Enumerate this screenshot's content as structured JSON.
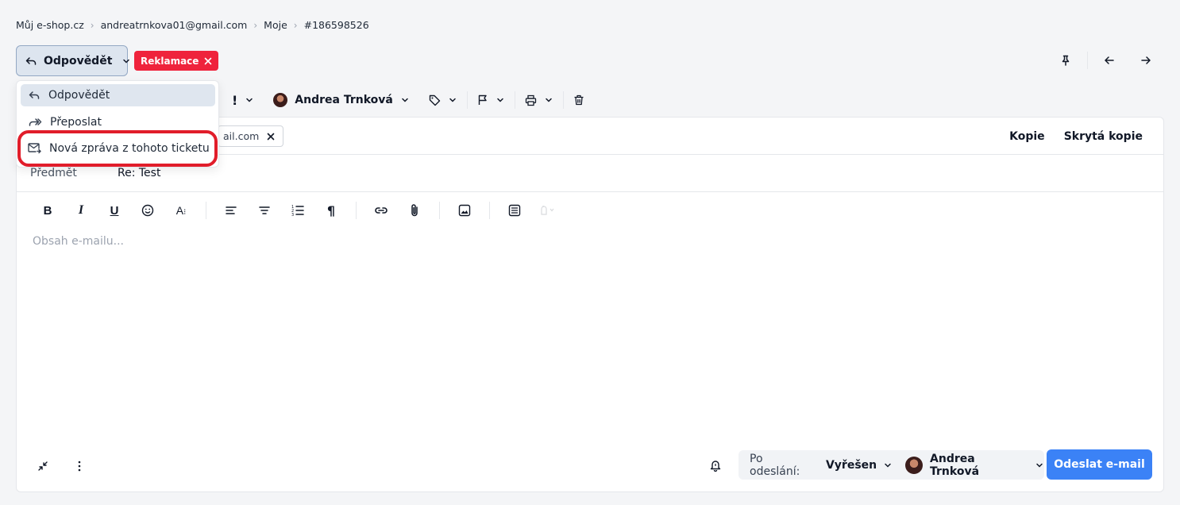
{
  "breadcrumb": [
    "Můj e-shop.cz",
    "andreatrnkova01@gmail.com",
    "Moje",
    "#186598526"
  ],
  "reply_button": {
    "label": "Odpovědět"
  },
  "tag": {
    "label": "Reklamace",
    "color": "#ef233c"
  },
  "dropdown": {
    "items": [
      {
        "label": "Odpovědět",
        "icon": "reply-icon",
        "active": true
      },
      {
        "label": "Přeposlat",
        "icon": "forward-icon"
      },
      {
        "label": "Nová zpráva z tohoto ticketu",
        "icon": "new-mail-icon",
        "highlighted": true
      }
    ]
  },
  "toolbar": {
    "priority": "!",
    "assignee": "Andrea Trnková"
  },
  "recipient": {
    "chip_text": "ail.com"
  },
  "cc": {
    "copy": "Kopie",
    "bcc": "Skrytá kopie"
  },
  "subject": {
    "label": "Předmět",
    "value": "Re: Test"
  },
  "editor": {
    "placeholder": "Obsah e-mailu..."
  },
  "footer": {
    "after_send_label": "Po odeslání:",
    "after_send_status": "Vyřešen",
    "assignee": "Andrea Trnková",
    "send_label": "Odeslat e-mail"
  },
  "colors": {
    "accent": "#3b82f6",
    "highlight": "#e11d2a"
  }
}
